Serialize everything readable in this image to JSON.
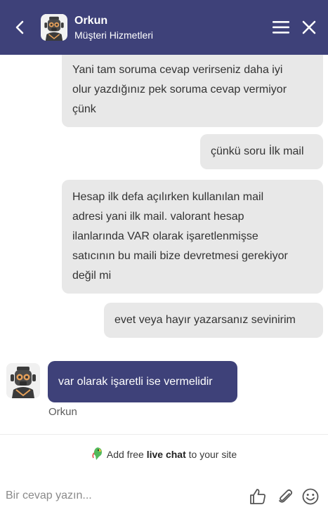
{
  "header": {
    "agent_name": "Orkun",
    "agent_role": "Müşteri Hizmetleri"
  },
  "messages": [
    {
      "direction": "out",
      "lines": [
        "Yani tam soruma cevap verirseniz daha iyi",
        "olur yazdığınız pek soruma cevap vermiyor",
        "çünk"
      ]
    },
    {
      "direction": "out",
      "lines": [
        "çünkü soru İlk mail"
      ]
    },
    {
      "direction": "out",
      "lines": [
        "Hesap ilk defa açılırken kullanılan mail",
        "adresi yani ilk mail. valorant hesap",
        "ilanlarında VAR olarak işaretlenmişse",
        "satıcının bu maili bize devretmesi gerekiyor",
        "değil mi"
      ]
    },
    {
      "direction": "out",
      "lines": [
        "evet veya hayır yazarsanız sevinirim"
      ]
    },
    {
      "direction": "in",
      "lines": [
        "var olarak işaretli ise vermelidir"
      ],
      "author": "Orkun"
    }
  ],
  "branding": {
    "prefix": "Add free ",
    "emphasis": "live chat",
    "suffix": " to your site"
  },
  "composer": {
    "placeholder": "Bir cevap yazın..."
  },
  "colors": {
    "brand": "#3e4179",
    "bubble_out": "#e8e8e8"
  },
  "icons": [
    "back-chevron-icon",
    "robot-avatar-icon",
    "hamburger-menu-icon",
    "close-icon",
    "parrot-logo-icon",
    "thumbs-up-icon",
    "paperclip-icon",
    "smiley-icon"
  ]
}
